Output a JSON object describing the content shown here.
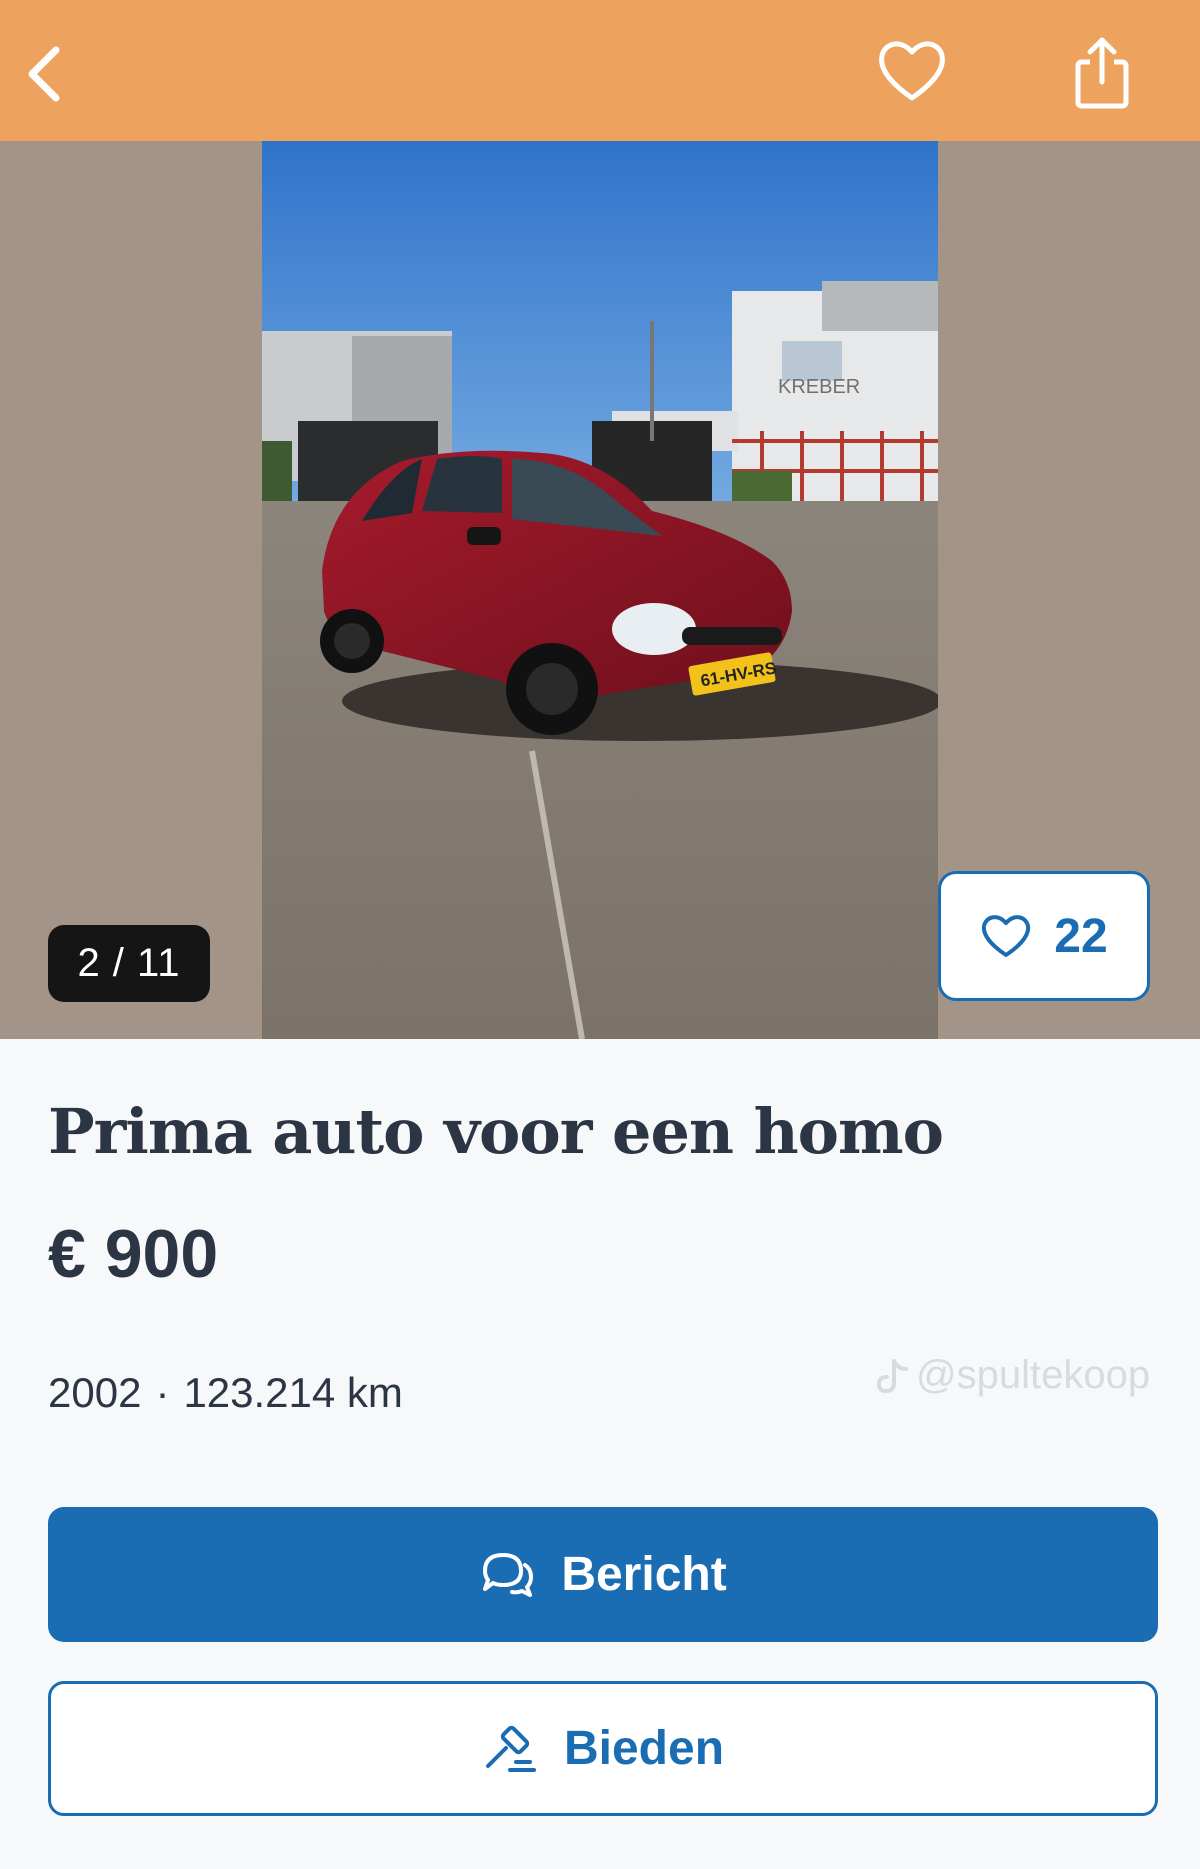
{
  "colors": {
    "header_bg": "#eda35d",
    "gallery_bg": "#a49487",
    "accent": "#1a6db3",
    "text": "#2b3544"
  },
  "header": {
    "icons": [
      "chevron-left-icon",
      "heart-icon",
      "share-icon"
    ]
  },
  "gallery": {
    "counter": "2 / 11",
    "likes_count": "22",
    "plate": "61-HV-RS",
    "building_sign": "KREBER"
  },
  "listing": {
    "title": "Prima auto voor een homo",
    "price": "€ 900",
    "year": "2002",
    "separator": "·",
    "mileage": "123.214 km"
  },
  "watermark": {
    "text": "@spultekoop"
  },
  "actions": {
    "message_label": "Bericht",
    "bid_label": "Bieden"
  }
}
